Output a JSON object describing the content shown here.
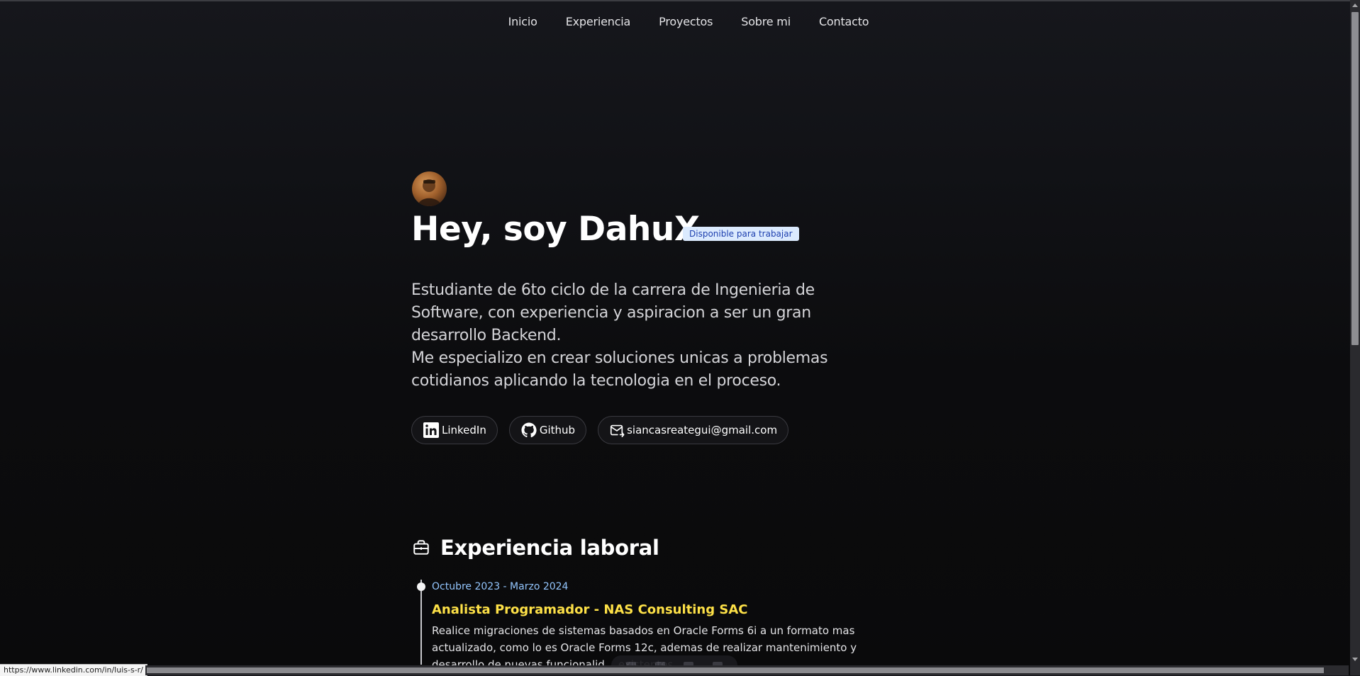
{
  "nav": {
    "items": [
      {
        "label": "Inicio"
      },
      {
        "label": "Experiencia"
      },
      {
        "label": "Proyectos"
      },
      {
        "label": "Sobre mi"
      },
      {
        "label": "Contacto"
      }
    ]
  },
  "hero": {
    "title": "Hey, soy DahuX",
    "badge": "Disponible para trabajar",
    "intro_line1": "Estudiante de 6to ciclo de la carrera de Ingenieria de Software, con experiencia y aspiracion a ser un gran desarrollo Backend.",
    "intro_line2": "Me especializo en crear soluciones unicas a problemas cotidianos aplicando la tecnologia en el proceso."
  },
  "social": {
    "linkedin": "LinkedIn",
    "github": "Github",
    "email": "siancasreategui@gmail.com"
  },
  "experience": {
    "heading": "Experiencia laboral",
    "items": [
      {
        "date": "Octubre 2023 - Marzo 2024",
        "role": "Analista Programador - NAS Consulting SAC",
        "description": "Realice migraciones de sistemas basados en Oracle Forms 6i a un formato mas actualizado, como lo es Oracle Forms 12c, ademas de realizar mantenimiento y desarrollo de nuevas funcionalid... existentes."
      }
    ]
  },
  "status_bar": {
    "url": "https://www.linkedin.com/in/luis-s-r/"
  },
  "colors": {
    "badge_bg": "#dbeafe",
    "badge_text": "#1e40af",
    "date_color": "#93c5fd",
    "role_color": "#fde047"
  },
  "icons": [
    "linkedin-icon",
    "github-icon",
    "mail-icon",
    "briefcase-icon"
  ]
}
